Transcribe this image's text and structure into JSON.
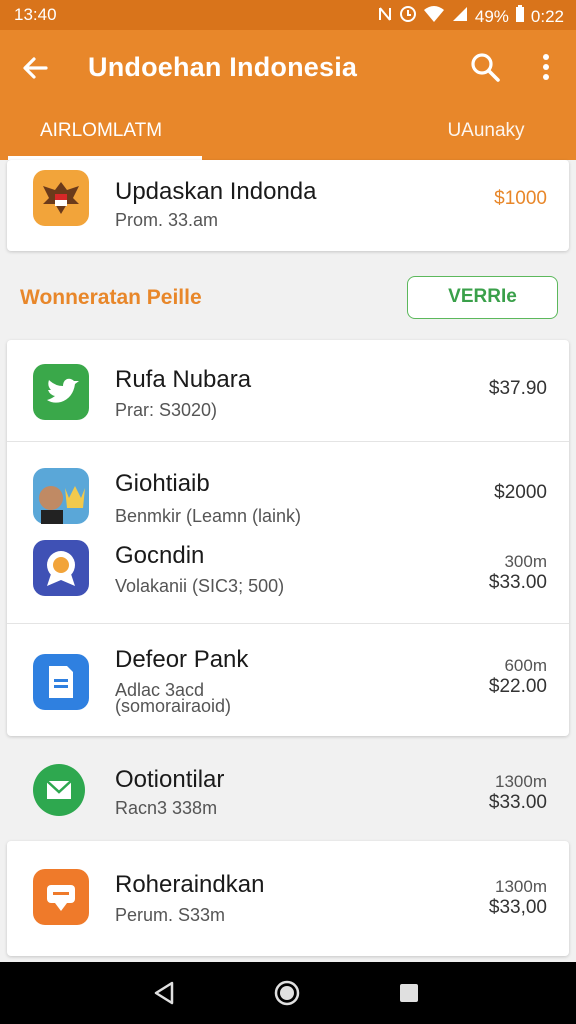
{
  "status": {
    "time": "13:40",
    "battery_text": "49%",
    "clock_right": "0:22"
  },
  "appbar": {
    "title": "Undoehan Indonesia",
    "icons": [
      "back-arrow-icon",
      "search-icon",
      "more-vert-icon"
    ]
  },
  "tabs": [
    {
      "label": "AIRLOMLATM",
      "active": true
    },
    {
      "label": "UAunaky",
      "active": false
    }
  ],
  "top_item": {
    "name": "Updaskan Indonda",
    "sub": "Prom. 33.am",
    "price": "$1000",
    "icon": "garuda-emblem-icon"
  },
  "section": {
    "label": "Wonneratan Peille",
    "button": "VERRIe"
  },
  "items": [
    {
      "name": "Rufa Nubara",
      "sub": "Prar: S3020)",
      "price": "$37.90",
      "meta": "",
      "icon": "bird-icon",
      "icon_color": "#3aa84a"
    },
    {
      "name": "Giohtiaib",
      "sub": "Benmkir (Leamn (laink)",
      "price": "$2000",
      "meta": "",
      "icon": "avatar-crown-icon",
      "icon_color": "#5aa7d8"
    },
    {
      "name": "Gocndin",
      "sub": "Volakanii (SIC3; 500)",
      "price": "$33.00",
      "meta": "300m",
      "icon": "badge-icon",
      "icon_color": "#3f51b5"
    },
    {
      "name": "Defeor Pank",
      "sub": "Adlac 3acd",
      "sub2": "(somorairaoid)",
      "price": "$22.00",
      "meta": "600m",
      "icon": "document-icon",
      "icon_color": "#2f80e0"
    },
    {
      "name": "Ootiontilar",
      "sub": "Racn3 338m",
      "price": "$33.00",
      "meta": "1300m",
      "icon": "mail-icon",
      "icon_color": "#2ea84f"
    },
    {
      "name": "Roheraindkan",
      "sub": "Perum. S33m",
      "price": "$33,00",
      "meta": "1300m",
      "icon": "chat-icon",
      "icon_color": "#ef7a2a"
    }
  ],
  "colors": {
    "appbar": "#e8872a",
    "statusbar": "#d9741b",
    "accent_green": "#3aa04a"
  },
  "navbar": {
    "icons": [
      "nav-back-icon",
      "nav-home-icon",
      "nav-recents-icon"
    ]
  }
}
